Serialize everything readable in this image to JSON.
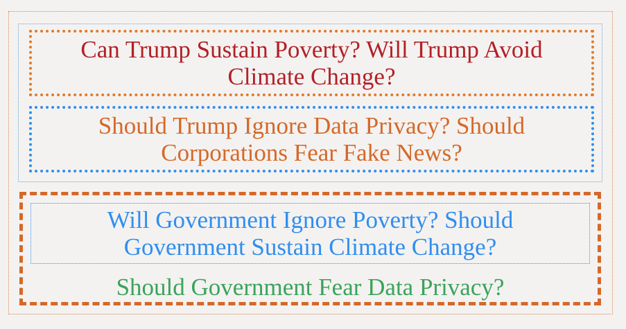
{
  "boxes": [
    {
      "line1": "Can Trump Sustain Poverty? Will Trump Avoid",
      "line2": "Climate Change?"
    },
    {
      "line1": "Should Trump Ignore Data Privacy? Should",
      "line2": "Corporations Fear Fake News?"
    },
    {
      "line1": "Will Government Ignore Poverty? Should",
      "line2": "Government Sustain Climate Change?"
    },
    {
      "line1": "Should Government Fear Data Privacy?"
    }
  ],
  "colors": {
    "background": "#f4f2f0",
    "dark_red": "#b22027",
    "orange": "#d4692a",
    "blue": "#2f8ef0",
    "green": "#3aa35c"
  }
}
